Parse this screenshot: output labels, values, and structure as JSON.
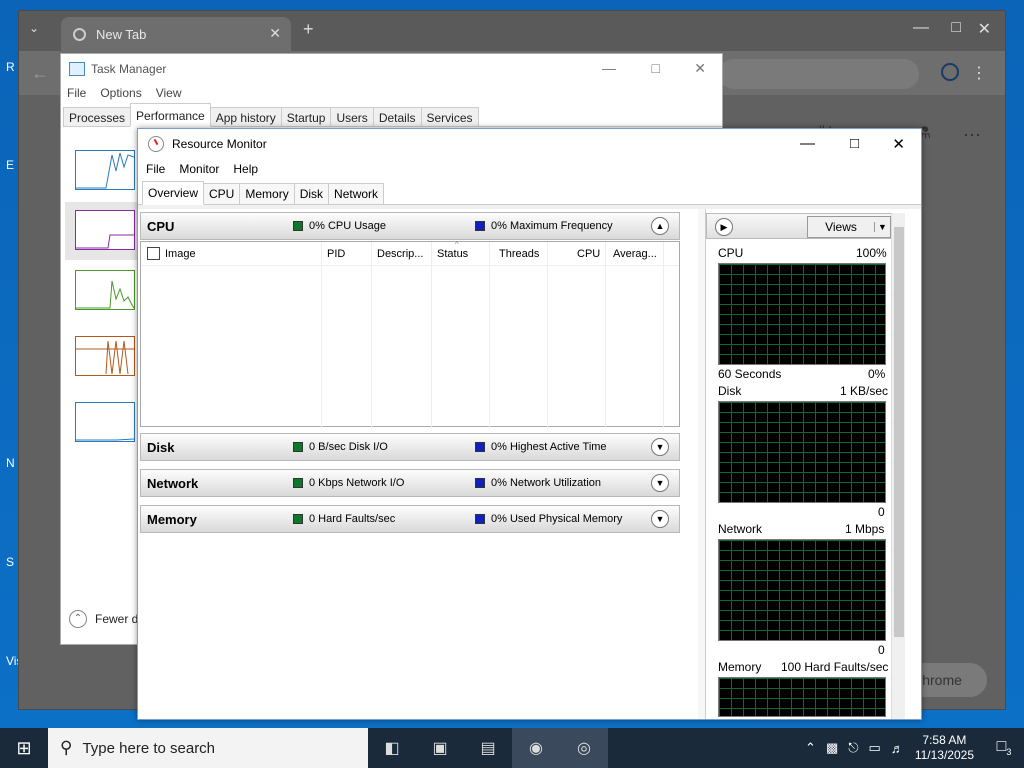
{
  "chrome": {
    "tab_title": "New Tab",
    "tab_close": "✕",
    "new_tab": "+",
    "dropdown": "⌄",
    "content_links": "ll    Image",
    "customize_button": "Chrome"
  },
  "task_manager": {
    "title": "Task Manager",
    "menu": [
      "File",
      "Options",
      "View"
    ],
    "tabs": [
      "Processes",
      "Performance",
      "App history",
      "Startup",
      "Users",
      "Details",
      "Services"
    ],
    "active_tab": "Performance",
    "fewer_details": "Fewer de"
  },
  "resource_monitor": {
    "title": "Resource Monitor",
    "menu": [
      "File",
      "Monitor",
      "Help"
    ],
    "tabs": [
      "Overview",
      "CPU",
      "Memory",
      "Disk",
      "Network"
    ],
    "active_tab": "Overview",
    "sections": {
      "cpu": {
        "name": "CPU",
        "metric1": "0% CPU Usage",
        "metric2": "0% Maximum Frequency"
      },
      "disk": {
        "name": "Disk",
        "metric1": "0 B/sec Disk I/O",
        "metric2": "0% Highest Active Time"
      },
      "network": {
        "name": "Network",
        "metric1": "0 Kbps Network I/O",
        "metric2": "0% Network Utilization"
      },
      "memory": {
        "name": "Memory",
        "metric1": "0 Hard Faults/sec",
        "metric2": "0% Used Physical Memory"
      }
    },
    "cpu_columns": [
      "Image",
      "PID",
      "Descrip...",
      "Status",
      "Threads",
      "CPU",
      "Averag..."
    ],
    "views_button": "Views",
    "graphs": {
      "cpu": {
        "label": "CPU",
        "max": "100%",
        "footer_left": "60 Seconds",
        "footer_right": "0%"
      },
      "disk": {
        "label": "Disk",
        "max": "1 KB/sec",
        "footer_right": "0"
      },
      "network": {
        "label": "Network",
        "max": "1 Mbps",
        "footer_right": "0"
      },
      "memory": {
        "label": "Memory",
        "max": "100 Hard Faults/sec"
      }
    }
  },
  "taskbar": {
    "search_placeholder": "Type here to search",
    "time": "7:58 AM",
    "date": "11/13/2025",
    "notification_count": "3"
  },
  "desktop_letters": [
    "R",
    "E",
    "N",
    "S",
    "Vis"
  ]
}
